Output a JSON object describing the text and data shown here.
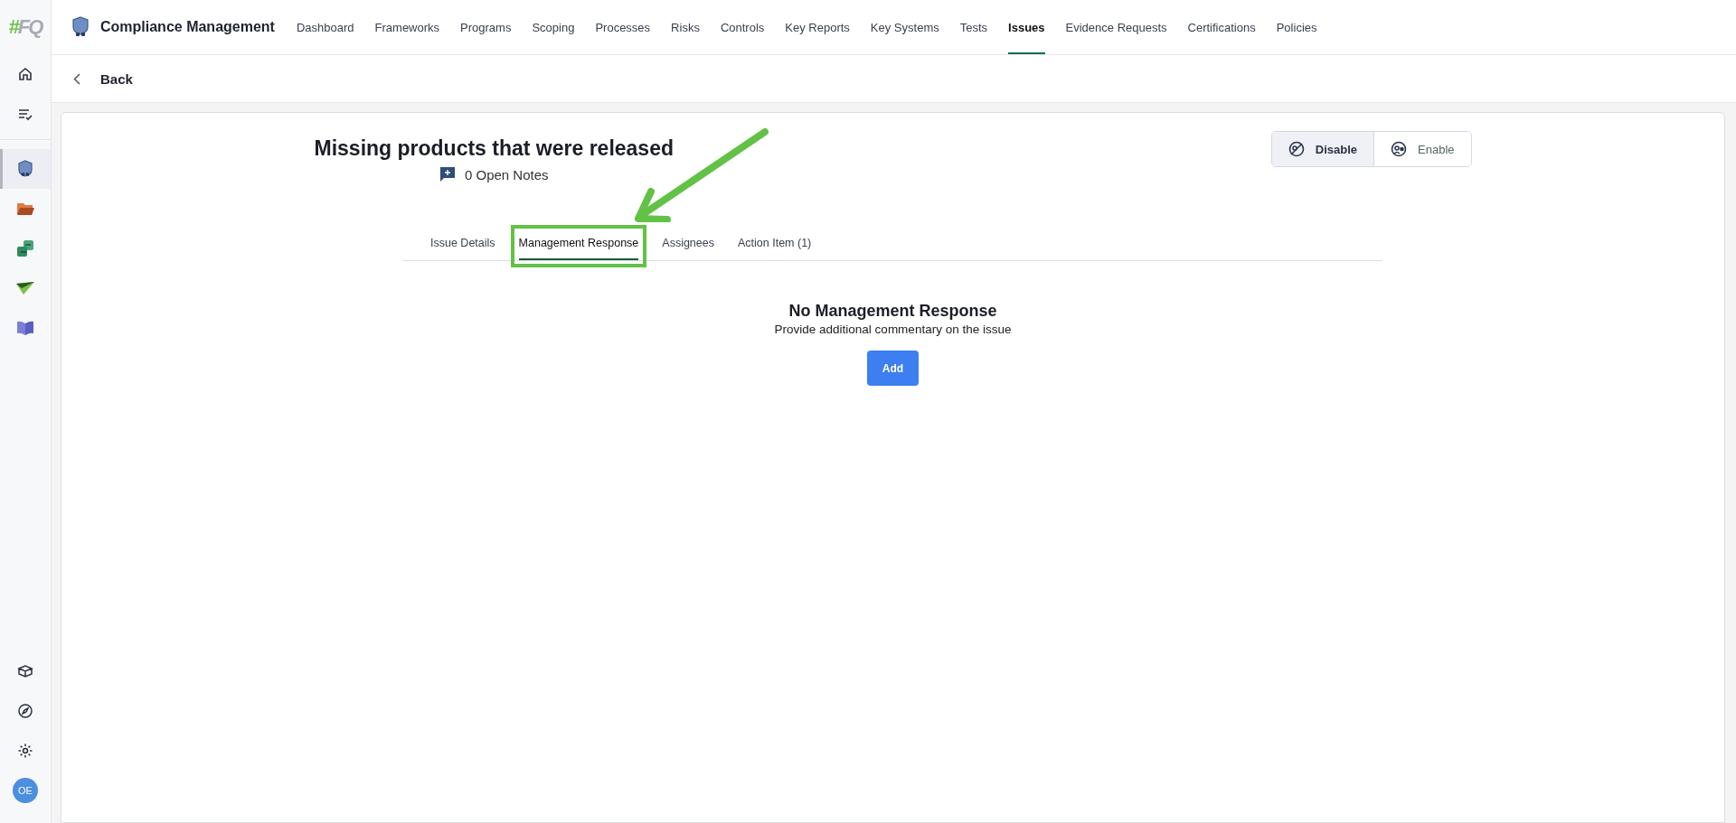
{
  "logo": {
    "mark": "#",
    "text": "FQ"
  },
  "sidebar": {
    "top_items": [
      {
        "selected": false
      },
      {
        "selected": false
      }
    ],
    "app_items": [
      {
        "selected": true
      },
      {
        "selected": false
      },
      {
        "selected": false
      },
      {
        "selected": false
      },
      {
        "selected": false
      }
    ],
    "bottom_items": [
      {
        "selected": false
      },
      {
        "selected": false
      },
      {
        "selected": false
      }
    ],
    "avatar": "OE"
  },
  "app_title": "Compliance Management",
  "nav": [
    {
      "label": "Dashboard",
      "selected": false
    },
    {
      "label": "Frameworks",
      "selected": false
    },
    {
      "label": "Programs",
      "selected": false
    },
    {
      "label": "Scoping",
      "selected": false
    },
    {
      "label": "Processes",
      "selected": false
    },
    {
      "label": "Risks",
      "selected": false
    },
    {
      "label": "Controls",
      "selected": false
    },
    {
      "label": "Key Reports",
      "selected": false
    },
    {
      "label": "Key Systems",
      "selected": false
    },
    {
      "label": "Tests",
      "selected": false
    },
    {
      "label": "Issues",
      "selected": true
    },
    {
      "label": "Evidence Requests",
      "selected": false
    },
    {
      "label": "Certifications",
      "selected": false
    },
    {
      "label": "Policies",
      "selected": false
    }
  ],
  "back": "Back",
  "issue": {
    "title": "Missing products that were released",
    "notes": "0 Open Notes"
  },
  "toggle": [
    {
      "label": "Disable",
      "selected": true
    },
    {
      "label": "Enable",
      "selected": false
    }
  ],
  "tabs": [
    {
      "label": "Issue Details",
      "selected": false,
      "highlighted": false
    },
    {
      "label": "Management Response",
      "selected": true,
      "highlighted": true
    },
    {
      "label": "Assignees",
      "selected": false,
      "highlighted": false
    },
    {
      "label": "Action Item (1)",
      "selected": false,
      "highlighted": false
    }
  ],
  "empty": {
    "title": "No Management Response",
    "subtitle": "Provide additional commentary on the issue",
    "button": "Add"
  }
}
